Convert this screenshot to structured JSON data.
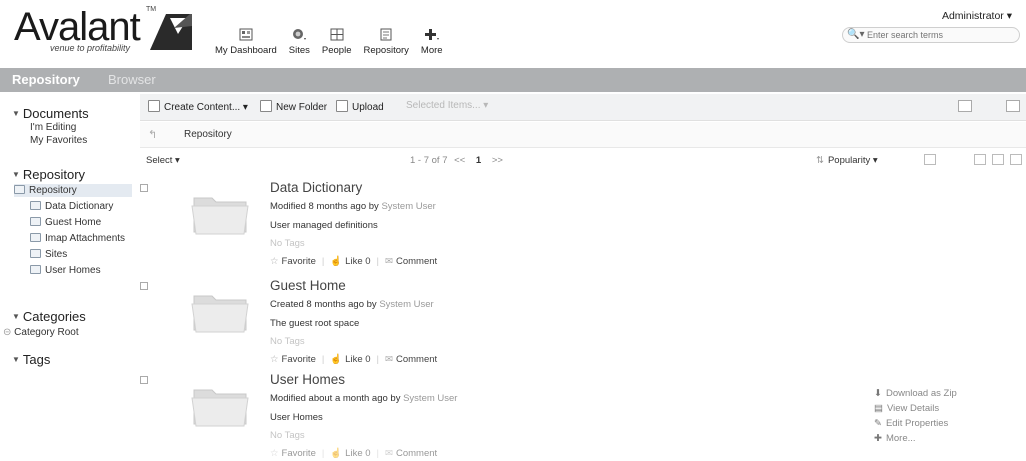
{
  "brand": {
    "name": "Avalant",
    "tagline": "venue to profitability",
    "trademark": "TM"
  },
  "nav": [
    {
      "label": "My Dashboard",
      "icon": "dashboard-icon"
    },
    {
      "label": "Sites",
      "icon": "sites-icon"
    },
    {
      "label": "People",
      "icon": "people-icon"
    },
    {
      "label": "Repository",
      "icon": "repository-icon"
    },
    {
      "label": "More",
      "icon": "plus-icon"
    }
  ],
  "user_menu": "Administrator ▾",
  "search": {
    "placeholder": "Enter search terms"
  },
  "title": {
    "main": "Repository",
    "sub": "Browser"
  },
  "sidebar": {
    "documents": {
      "label": "Documents",
      "items": [
        "I'm Editing",
        "My Favorites"
      ]
    },
    "repository": {
      "label": "Repository",
      "root": "Repository",
      "items": [
        "Data Dictionary",
        "Guest Home",
        "Imap Attachments",
        "Sites",
        "User Homes"
      ]
    },
    "categories": {
      "label": "Categories",
      "root": "Category Root"
    },
    "tags": {
      "label": "Tags"
    }
  },
  "toolbar": {
    "create": "Create Content... ▾",
    "new_folder": "New Folder",
    "upload": "Upload",
    "selected": "Selected Items... ▾"
  },
  "breadcrumb": "Repository",
  "paging": {
    "select": "Select ▾",
    "summary": "1 - 7 of 7",
    "prev": "<<",
    "page": "1",
    "next": ">>",
    "sort": "Popularity ▾"
  },
  "items": [
    {
      "name": "Data Dictionary",
      "modified_prefix": "Modified 8 months ago by",
      "user": "System User",
      "description": "User managed definitions",
      "tags": "No Tags",
      "favorite": "Favorite",
      "like": "Like",
      "like_count": "0",
      "comment": "Comment"
    },
    {
      "name": "Guest Home",
      "modified_prefix": "Created 8 months ago by",
      "user": "System User",
      "description": "The guest root space",
      "tags": "No Tags",
      "favorite": "Favorite",
      "like": "Like",
      "like_count": "0",
      "comment": "Comment"
    },
    {
      "name": "User Homes",
      "modified_prefix": "Modified about a month ago by",
      "user": "System User",
      "description": "User Homes",
      "tags": "No Tags",
      "favorite": "Favorite",
      "like": "Like",
      "like_count": "0",
      "comment": "Comment"
    }
  ],
  "row_actions": [
    "Download as Zip",
    "View Details",
    "Edit Properties",
    "More..."
  ]
}
